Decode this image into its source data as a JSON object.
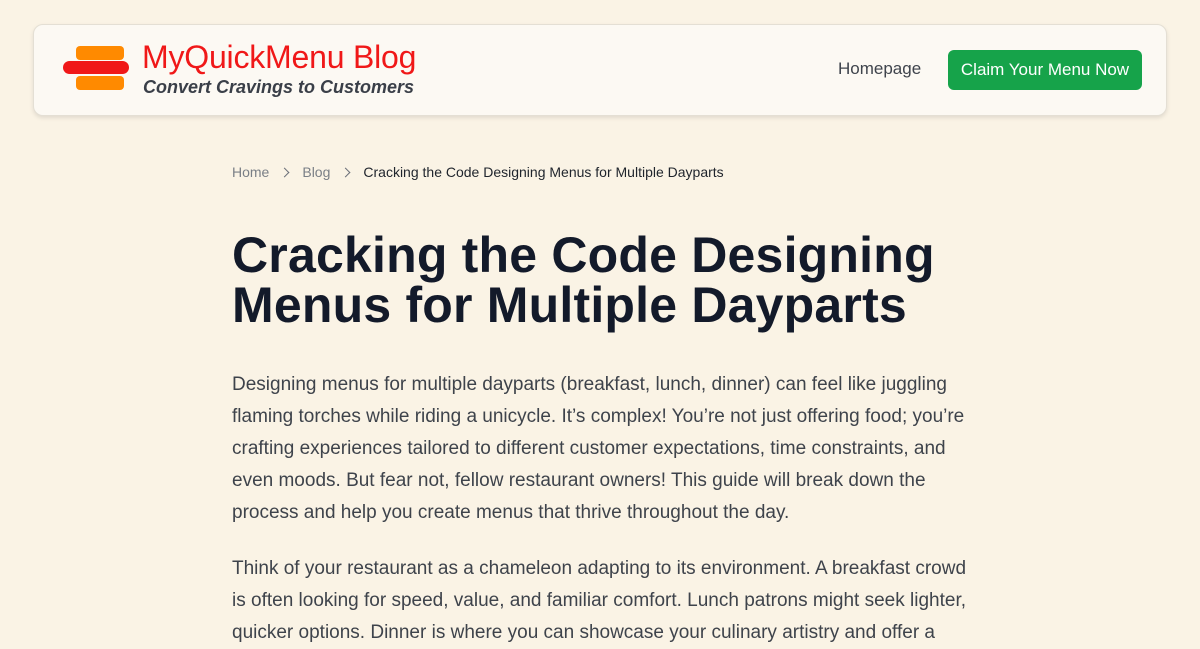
{
  "header": {
    "brand_title": "MyQuickMenu Blog",
    "brand_tagline": "Convert Cravings to Customers",
    "nav_homepage": "Homepage",
    "cta_label": "Claim Your Menu Now",
    "colors": {
      "brand": "#f01818",
      "logo_accent": "#ff8a00",
      "cta": "#16a34a",
      "background": "#faf3e5"
    }
  },
  "breadcrumb": {
    "items": [
      "Home",
      "Blog",
      "Cracking the Code Designing Menus for Multiple Dayparts"
    ],
    "separator_icon": "chevron-right-icon"
  },
  "article": {
    "title": "Cracking the Code Designing Menus for Multiple Dayparts",
    "paragraphs": [
      "Designing menus for multiple dayparts (breakfast, lunch, dinner) can feel like juggling flaming torches while riding a unicycle. It’s complex! You’re not just offering food; you’re crafting experiences tailored to different customer expectations, time constraints, and even moods. But fear not, fellow restaurant owners! This guide will break down the process and help you create menus that thrive throughout the day.",
      "Think of your restaurant as a chameleon adapting to its environment. A breakfast crowd is often looking for speed, value, and familiar comfort. Lunch patrons might seek lighter, quicker options. Dinner is where you can showcase your culinary artistry and offer a"
    ]
  }
}
